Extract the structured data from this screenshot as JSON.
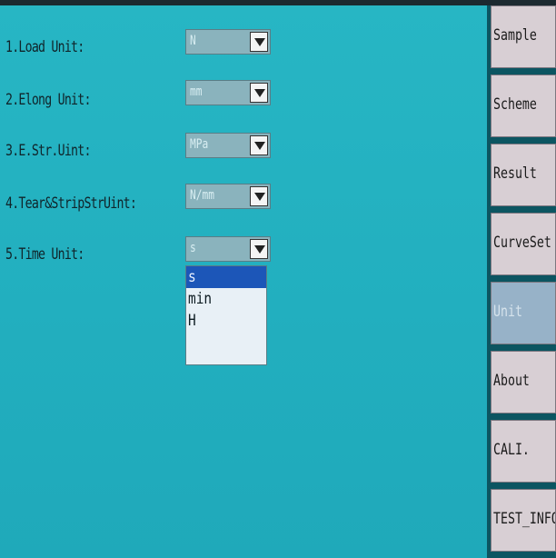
{
  "settings": [
    {
      "label": "1.Load Unit:",
      "value": "N"
    },
    {
      "label": "2.Elong Unit:",
      "value": "mm"
    },
    {
      "label": "3.E.Str.Uint:",
      "value": "MPa"
    },
    {
      "label": "4.Tear&StripStrUint:",
      "value": "N/mm"
    },
    {
      "label": "5.Time Unit:",
      "value": "s"
    }
  ],
  "time_unit_dropdown": {
    "options": [
      "s",
      "min",
      "H"
    ],
    "selected_index": 0
  },
  "sidebar": {
    "tabs": [
      {
        "label": "Sample"
      },
      {
        "label": "Scheme"
      },
      {
        "label": "Result"
      },
      {
        "label": "CurveSet"
      },
      {
        "label": "Unit"
      },
      {
        "label": "About"
      },
      {
        "label": "CALI."
      },
      {
        "label": "TEST_INFO"
      }
    ],
    "active_tab": "Unit"
  },
  "colors": {
    "background": "#22afbf",
    "dropdown_selected": "#1c56b8",
    "tab": "#d8cfd4",
    "tab_active": "#97b2c8"
  }
}
